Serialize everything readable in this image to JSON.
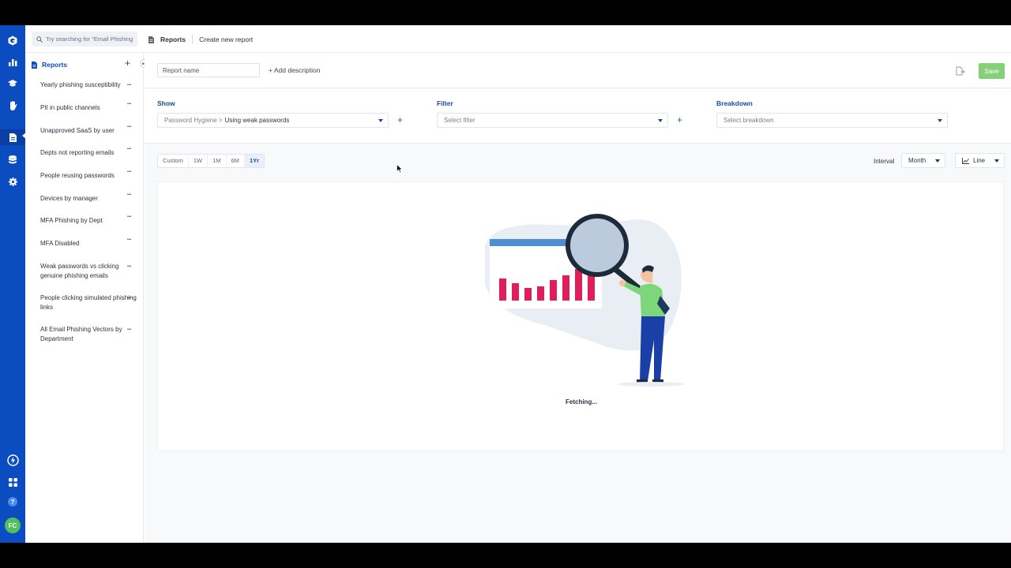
{
  "rail": {
    "icons": [
      "logo-icon",
      "chart-icon",
      "graduation-cap-icon",
      "hand-icon",
      "report-icon",
      "database-icon",
      "gear-icon",
      "lightning-icon",
      "apps-grid-icon",
      "help-icon"
    ],
    "avatar_initials": "FC",
    "brand_color": "#0b4cc0"
  },
  "search": {
    "placeholder": "Try searching for \"Email Phishing\""
  },
  "breadcrumb": {
    "section": "Reports",
    "page": "Create new report"
  },
  "sidebar": {
    "title": "Reports",
    "items": [
      {
        "label": "Yearly phishing susceptibility"
      },
      {
        "label": "PII in public channels"
      },
      {
        "label": "Unapproved SaaS by user"
      },
      {
        "label": "Depts not reporting emails"
      },
      {
        "label": "People reusing passwords"
      },
      {
        "label": "Devices by manager"
      },
      {
        "label": "MFA Phishing by Dept"
      },
      {
        "label": "MFA Disabled"
      },
      {
        "label": "Weak passwords vs clicking genuine phishing emails"
      },
      {
        "label": "People clicking simulated phishing links"
      },
      {
        "label": "All Email Phishing Vectors by Department"
      }
    ]
  },
  "header": {
    "report_name_placeholder": "Report name",
    "add_description": "+ Add description",
    "save_label": "Save",
    "save_color": "#86d07a"
  },
  "config": {
    "show_label": "Show",
    "show_prefix": "Password Hygiene > ",
    "show_value": "Using weak passwords",
    "filter_label": "Filter",
    "filter_placeholder": "Select filter",
    "breakdown_label": "Breakdown",
    "breakdown_placeholder": "Select breakdown"
  },
  "ranges": {
    "items": [
      "Custom",
      "1W",
      "1M",
      "6M",
      "1Yr"
    ],
    "active": "1Yr"
  },
  "interval": {
    "label": "Interval",
    "value": "Month"
  },
  "chart_type": {
    "value": "Line"
  },
  "status": {
    "text": "Fetching..."
  }
}
